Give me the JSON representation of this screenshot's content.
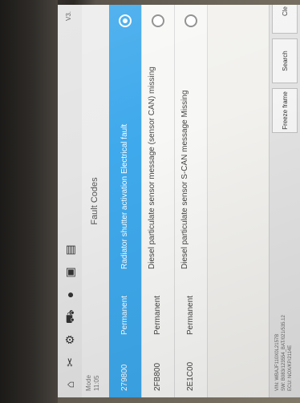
{
  "app": {
    "version": "V3.",
    "mode_label": "Mode",
    "mode_sub": "11:05",
    "title": "Fault Codes"
  },
  "toolbar": {
    "icons": [
      "home-icon",
      "scissors-icon",
      "settings-icon",
      "shop-icon",
      "camera-icon",
      "print-icon",
      "menu-icon"
    ]
  },
  "fault_codes": [
    {
      "code": "279800",
      "status": "Permanent",
      "description": "Radiator shutter activation Electrical fault",
      "selected": true
    },
    {
      "code": "2FB800",
      "status": "Permanent",
      "description": "Diesel particulate sensor message (sensor CAN) missing",
      "selected": false
    },
    {
      "code": "2E1C00",
      "status": "Permanent",
      "description": "Diesel particulate sensor S-CAN message Missing",
      "selected": false
    }
  ],
  "footer": {
    "vin_lines": [
      "VIN: WBAJF110X0L2157B",
      "SW: B083/123554_BAT/021/535.12",
      "ECU: NOX/KP/2114E"
    ],
    "freeze_frame_label": "Freeze frame",
    "search_label": "Search",
    "clear_label": "Cle"
  }
}
